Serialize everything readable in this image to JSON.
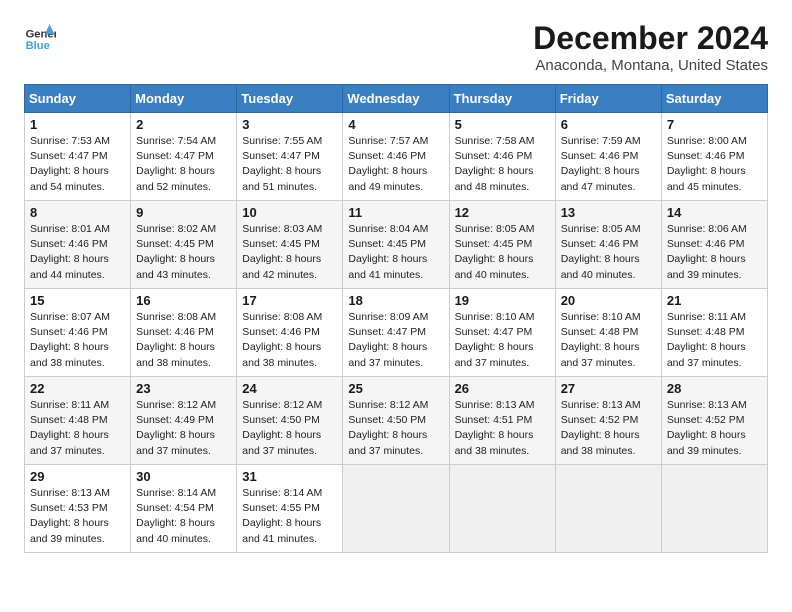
{
  "header": {
    "logo_line1": "General",
    "logo_line2": "Blue",
    "month": "December 2024",
    "location": "Anaconda, Montana, United States"
  },
  "days_of_week": [
    "Sunday",
    "Monday",
    "Tuesday",
    "Wednesday",
    "Thursday",
    "Friday",
    "Saturday"
  ],
  "weeks": [
    [
      {
        "day": 1,
        "sunrise": "7:53 AM",
        "sunset": "4:47 PM",
        "daylight": "8 hours and 54 minutes."
      },
      {
        "day": 2,
        "sunrise": "7:54 AM",
        "sunset": "4:47 PM",
        "daylight": "8 hours and 52 minutes."
      },
      {
        "day": 3,
        "sunrise": "7:55 AM",
        "sunset": "4:47 PM",
        "daylight": "8 hours and 51 minutes."
      },
      {
        "day": 4,
        "sunrise": "7:57 AM",
        "sunset": "4:46 PM",
        "daylight": "8 hours and 49 minutes."
      },
      {
        "day": 5,
        "sunrise": "7:58 AM",
        "sunset": "4:46 PM",
        "daylight": "8 hours and 48 minutes."
      },
      {
        "day": 6,
        "sunrise": "7:59 AM",
        "sunset": "4:46 PM",
        "daylight": "8 hours and 47 minutes."
      },
      {
        "day": 7,
        "sunrise": "8:00 AM",
        "sunset": "4:46 PM",
        "daylight": "8 hours and 45 minutes."
      }
    ],
    [
      {
        "day": 8,
        "sunrise": "8:01 AM",
        "sunset": "4:46 PM",
        "daylight": "8 hours and 44 minutes."
      },
      {
        "day": 9,
        "sunrise": "8:02 AM",
        "sunset": "4:45 PM",
        "daylight": "8 hours and 43 minutes."
      },
      {
        "day": 10,
        "sunrise": "8:03 AM",
        "sunset": "4:45 PM",
        "daylight": "8 hours and 42 minutes."
      },
      {
        "day": 11,
        "sunrise": "8:04 AM",
        "sunset": "4:45 PM",
        "daylight": "8 hours and 41 minutes."
      },
      {
        "day": 12,
        "sunrise": "8:05 AM",
        "sunset": "4:45 PM",
        "daylight": "8 hours and 40 minutes."
      },
      {
        "day": 13,
        "sunrise": "8:05 AM",
        "sunset": "4:46 PM",
        "daylight": "8 hours and 40 minutes."
      },
      {
        "day": 14,
        "sunrise": "8:06 AM",
        "sunset": "4:46 PM",
        "daylight": "8 hours and 39 minutes."
      }
    ],
    [
      {
        "day": 15,
        "sunrise": "8:07 AM",
        "sunset": "4:46 PM",
        "daylight": "8 hours and 38 minutes."
      },
      {
        "day": 16,
        "sunrise": "8:08 AM",
        "sunset": "4:46 PM",
        "daylight": "8 hours and 38 minutes."
      },
      {
        "day": 17,
        "sunrise": "8:08 AM",
        "sunset": "4:46 PM",
        "daylight": "8 hours and 38 minutes."
      },
      {
        "day": 18,
        "sunrise": "8:09 AM",
        "sunset": "4:47 PM",
        "daylight": "8 hours and 37 minutes."
      },
      {
        "day": 19,
        "sunrise": "8:10 AM",
        "sunset": "4:47 PM",
        "daylight": "8 hours and 37 minutes."
      },
      {
        "day": 20,
        "sunrise": "8:10 AM",
        "sunset": "4:48 PM",
        "daylight": "8 hours and 37 minutes."
      },
      {
        "day": 21,
        "sunrise": "8:11 AM",
        "sunset": "4:48 PM",
        "daylight": "8 hours and 37 minutes."
      }
    ],
    [
      {
        "day": 22,
        "sunrise": "8:11 AM",
        "sunset": "4:48 PM",
        "daylight": "8 hours and 37 minutes."
      },
      {
        "day": 23,
        "sunrise": "8:12 AM",
        "sunset": "4:49 PM",
        "daylight": "8 hours and 37 minutes."
      },
      {
        "day": 24,
        "sunrise": "8:12 AM",
        "sunset": "4:50 PM",
        "daylight": "8 hours and 37 minutes."
      },
      {
        "day": 25,
        "sunrise": "8:12 AM",
        "sunset": "4:50 PM",
        "daylight": "8 hours and 37 minutes."
      },
      {
        "day": 26,
        "sunrise": "8:13 AM",
        "sunset": "4:51 PM",
        "daylight": "8 hours and 38 minutes."
      },
      {
        "day": 27,
        "sunrise": "8:13 AM",
        "sunset": "4:52 PM",
        "daylight": "8 hours and 38 minutes."
      },
      {
        "day": 28,
        "sunrise": "8:13 AM",
        "sunset": "4:52 PM",
        "daylight": "8 hours and 39 minutes."
      }
    ],
    [
      {
        "day": 29,
        "sunrise": "8:13 AM",
        "sunset": "4:53 PM",
        "daylight": "8 hours and 39 minutes."
      },
      {
        "day": 30,
        "sunrise": "8:14 AM",
        "sunset": "4:54 PM",
        "daylight": "8 hours and 40 minutes."
      },
      {
        "day": 31,
        "sunrise": "8:14 AM",
        "sunset": "4:55 PM",
        "daylight": "8 hours and 41 minutes."
      },
      null,
      null,
      null,
      null
    ]
  ]
}
